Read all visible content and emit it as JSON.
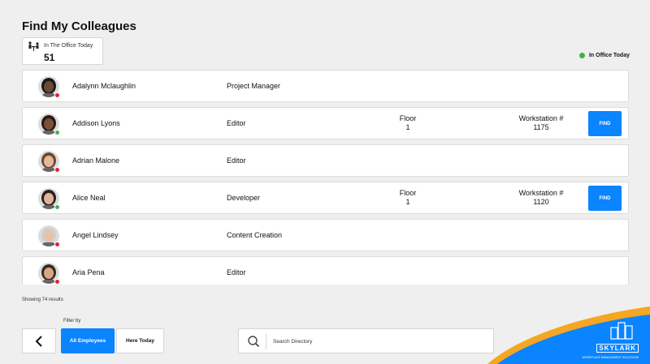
{
  "page_title": "Find My Colleagues",
  "office": {
    "label": "In The Office Today",
    "count": "51"
  },
  "legend": {
    "label": "In Office Today",
    "color": "#3bb54a"
  },
  "colors": {
    "accent": "#0a84ff",
    "present": "#3bb54a",
    "absent": "#e02424"
  },
  "colleagues": [
    {
      "name": "Adalynn Mclaughlin",
      "role": "Project Manager",
      "status": "absent",
      "skin": "#6b4a35",
      "hair": "#1a1a1a"
    },
    {
      "name": "Addison Lyons",
      "role": "Editor",
      "status": "present",
      "skin": "#7a5038",
      "hair": "#2a1a12",
      "floor_label": "Floor",
      "floor": "1",
      "ws_label": "Workstation #",
      "workstation": "1175",
      "find_label": "FIND"
    },
    {
      "name": "Adrian Malone",
      "role": "Editor",
      "status": "absent",
      "skin": "#e6b89a",
      "hair": "#6a4a30"
    },
    {
      "name": "Alice Neal",
      "role": "Developer",
      "status": "present",
      "skin": "#e0b49a",
      "hair": "#2b211c",
      "floor_label": "Floor",
      "floor": "1",
      "ws_label": "Workstation #",
      "workstation": "1120",
      "find_label": "FIND"
    },
    {
      "name": "Angel Lindsey",
      "role": "Content Creation",
      "status": "absent",
      "skin": "#e8c2a8",
      "hair": "#cfcfcf"
    },
    {
      "name": "Aria Pena",
      "role": "Editor",
      "status": "absent",
      "skin": "#d6a686",
      "hair": "#3a2a20"
    }
  ],
  "results_text": "Showing 74 results",
  "filter": {
    "label": "Filter by",
    "all": "All Employees",
    "here": "Here Today"
  },
  "search": {
    "placeholder": "Search Directory"
  },
  "brand": {
    "name": "SKYLARK",
    "tagline": "WORKPLACE MANAGEMENT SOLUTIONS"
  }
}
